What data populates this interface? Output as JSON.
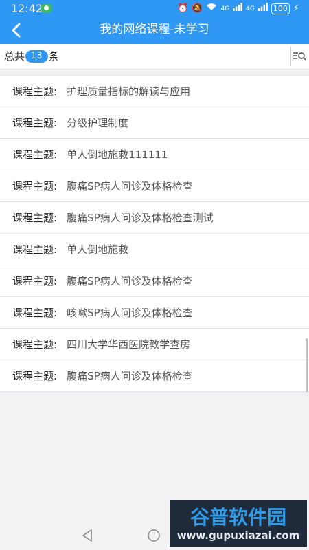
{
  "status_bar": {
    "time": "12:42",
    "network_1": "4G",
    "network_2": "4G",
    "battery": "100"
  },
  "header": {
    "title": "我的网络课程-未学习"
  },
  "count_bar": {
    "prefix": "总共",
    "count": "13",
    "suffix": "条"
  },
  "courses": {
    "label": "课程主题:",
    "items": [
      "护理质量指标的解读与应用",
      "分级护理制度",
      "单人倒地施救111111",
      "腹痛SP病人问诊及体格检查",
      "腹痛SP病人问诊及体格检查测试",
      "单人倒地施救",
      "腹痛SP病人问诊及体格检查",
      "咳嗽SP病人问诊及体格检查",
      "四川大学华西医院教学查房",
      "腹痛SP病人问诊及体格检查"
    ]
  },
  "watermark": {
    "title": "谷普软件园",
    "url": "www.gupuxiazai.com"
  },
  "colors": {
    "accent": "#2f98f4",
    "background": "#f2f2f4"
  }
}
